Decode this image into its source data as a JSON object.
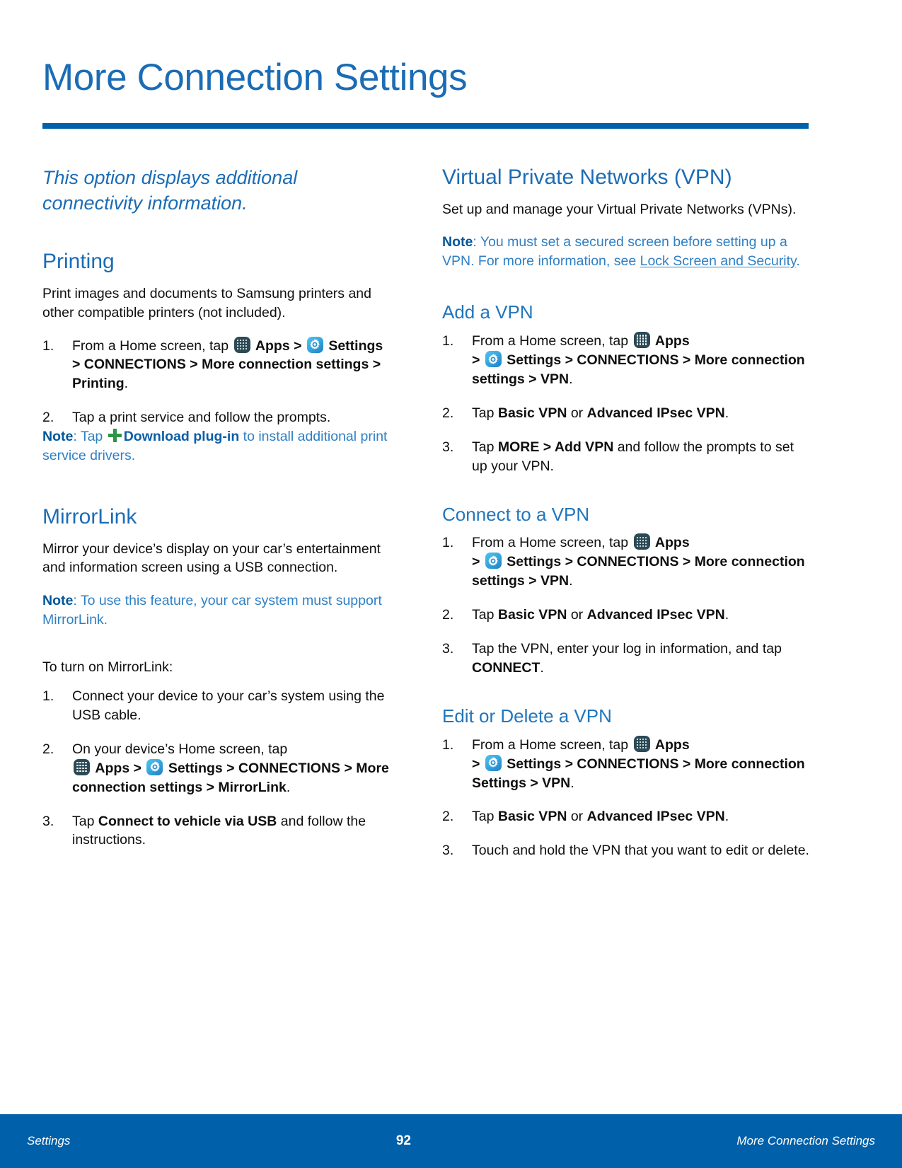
{
  "colors": {
    "accent_blue": "#1b6cb5",
    "rule_blue": "#0060a9",
    "note_blue": "#2e7fc4",
    "note_bold_blue": "#00569a",
    "plus_green": "#2c9446",
    "apps_icon_bg": "#2b4a56",
    "settings_icon_bg": "#39a9e0",
    "footer_bg": "#0060a9",
    "body_text": "#0f0f0f"
  },
  "page_title": "More Connection Settings",
  "lede": "This option displays additional connectivity information.",
  "left_column": {
    "printing": {
      "heading": "Printing",
      "intro": "Print images and documents to Samsung printers and other compatible printers (not included).",
      "steps": [
        {
          "parts": [
            {
              "t": "From a Home screen, tap ",
              "style": "normal"
            },
            {
              "t": "apps-icon",
              "style": "icon"
            },
            {
              "t": " ",
              "style": "normal"
            },
            {
              "t": "Apps",
              "style": "bold"
            },
            {
              "t": " > ",
              "style": "bold"
            },
            {
              "t": "settings-icon",
              "style": "icon"
            },
            {
              "t": " ",
              "style": "normal"
            },
            {
              "t": "Settings > CONNECTIONS > More connection settings > Printing",
              "style": "bold"
            },
            {
              "t": ".",
              "style": "normal"
            }
          ],
          "plain": "From a Home screen, tap Apps > Settings > CONNECTIONS > More connection settings > Printing."
        },
        {
          "parts": [
            {
              "t": "Tap a print service and follow the prompts.",
              "style": "normal"
            }
          ],
          "plain": "Tap a print service and follow the prompts."
        }
      ],
      "note": {
        "label": "Note",
        "sep": ": ",
        "pre": "Tap ",
        "icon": "plus-icon",
        "bold_link": "Download plug-in",
        "post": " to install additional print service drivers."
      }
    },
    "mirrorlink": {
      "heading": "MirrorLink",
      "intro": "Mirror your device’s display on your car’s entertainment and information screen using a USB connection.",
      "note": {
        "label": "Note",
        "sep": ": ",
        "text": "To use this feature, your car system must support MirrorLink."
      },
      "lead_in": "To turn on MirrorLink:",
      "steps": [
        {
          "plain": "Connect your device to your car’s system using the USB cable."
        },
        {
          "plain": "On your device’s Home screen, tap Apps > Settings > CONNECTIONS > More connection settings > MirrorLink.",
          "pre": "On your device’s Home screen, tap ",
          "bold_a": "Apps",
          "mid": " > ",
          "bold_b": "Settings > CONNECTIONS > More connection settings > MirrorLink",
          "post": "."
        },
        {
          "plain": "Tap Connect to vehicle via USB and follow the instructions.",
          "pre": "Tap ",
          "bold_a": "Connect to vehicle via USB",
          "post": " and follow the instructions."
        }
      ]
    }
  },
  "right_column": {
    "vpn": {
      "heading": "Virtual Private Networks (VPN)",
      "intro": "Set up and manage your Virtual Private Networks (VPNs).",
      "note": {
        "label": "Note",
        "sep": ": ",
        "pre": "You must set a secured screen before setting up a VPN. For more information, see ",
        "link": "Lock Screen and Security",
        "post": "."
      }
    },
    "add_vpn": {
      "heading": "Add a VPN",
      "steps": [
        {
          "pre": "From a Home screen, tap ",
          "bold_a": "Apps",
          "mid": " > ",
          "bold_b": "Settings > CONNECTIONS > More connection settings > VPN",
          "post": ".",
          "plain": "From a Home screen, tap Apps > Settings > CONNECTIONS > More connection settings > VPN."
        },
        {
          "pre": "Tap ",
          "bold_a": "Basic VPN",
          "mid": " or ",
          "bold_b": "Advanced IPsec VPN",
          "post": ".",
          "plain": "Tap Basic VPN or Advanced IPsec VPN."
        },
        {
          "pre": "Tap ",
          "bold_a": "MORE",
          "mid": " > ",
          "bold_b": "Add VPN",
          "post": " and follow the prompts to set up your VPN.",
          "plain": "Tap MORE > Add VPN and follow the prompts to set up your VPN."
        }
      ]
    },
    "connect_vpn": {
      "heading": "Connect to a VPN",
      "steps": [
        {
          "pre": "From a Home screen, tap ",
          "bold_a": "Apps",
          "mid": " > ",
          "bold_b": "Settings > CONNECTIONS > More connection settings > VPN",
          "post": ".",
          "plain": "From a Home screen, tap Apps > Settings > CONNECTIONS > More connection settings > VPN."
        },
        {
          "pre": "Tap ",
          "bold_a": "Basic VPN",
          "mid": " or ",
          "bold_b": "Advanced IPsec VPN",
          "post": ".",
          "plain": "Tap Basic VPN or Advanced IPsec VPN."
        },
        {
          "pre": "Tap the VPN, enter your log in information, and tap ",
          "bold_a": "CONNECT",
          "post": ".",
          "plain": "Tap the VPN, enter your log in information, and tap CONNECT."
        }
      ]
    },
    "edit_vpn": {
      "heading": "Edit or Delete a VPN",
      "steps": [
        {
          "pre": "From a Home screen, tap ",
          "bold_a": "Apps",
          "mid": " > ",
          "bold_b": "Settings > CONNECTIONS > More connection Settings > VPN",
          "post": ".",
          "plain": "From a Home screen, tap Apps > Settings > CONNECTIONS > More connection Settings > VPN."
        },
        {
          "pre": "Tap ",
          "bold_a": "Basic VPN",
          "mid": " or ",
          "bold_b": "Advanced IPsec VPN",
          "post": ".",
          "plain": "Tap Basic VPN or Advanced IPsec VPN."
        },
        {
          "pre": "Touch and hold the VPN that you want to edit or delete.",
          "plain": "Touch and hold the VPN that you want to edit or delete."
        }
      ]
    }
  },
  "footer": {
    "left": "Settings",
    "page_number": "92",
    "right": "More Connection Settings"
  }
}
